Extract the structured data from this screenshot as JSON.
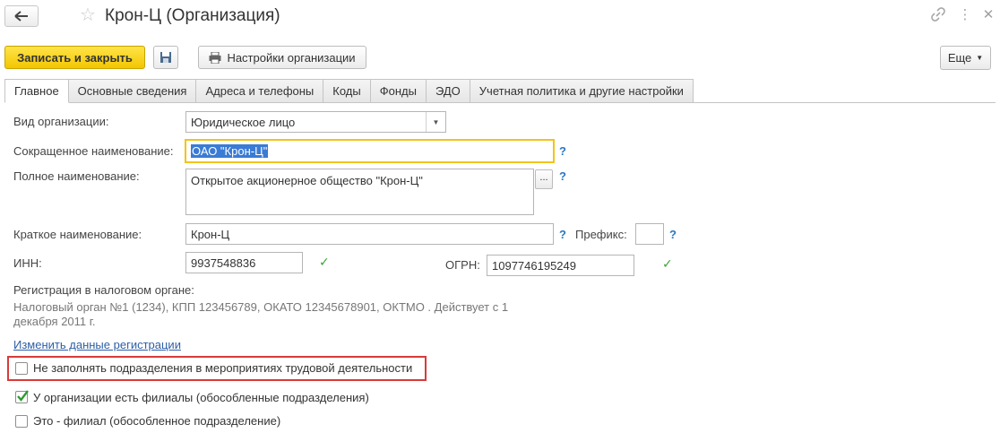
{
  "window": {
    "title": "Крон-Ц (Организация)"
  },
  "toolbar": {
    "save_close_label": "Записать и закрыть",
    "settings_label": "Настройки организации",
    "more_label": "Еще"
  },
  "tabs": [
    {
      "label": "Главное"
    },
    {
      "label": "Основные сведения"
    },
    {
      "label": "Адреса и телефоны"
    },
    {
      "label": "Коды"
    },
    {
      "label": "Фонды"
    },
    {
      "label": "ЭДО"
    },
    {
      "label": "Учетная политика и другие настройки"
    }
  ],
  "form": {
    "org_type_label": "Вид организации:",
    "org_type_value": "Юридическое лицо",
    "short_name_label": "Сокращенное наименование:",
    "short_name_value": "ОАО \"Крон-Ц\"",
    "full_name_label": "Полное наименование:",
    "full_name_value": "Открытое акционерное общество \"Крон-Ц\"",
    "brief_name_label": "Краткое наименование:",
    "brief_name_value": "Крон-Ц",
    "prefix_label": "Префикс:",
    "prefix_value": "",
    "inn_label": "ИНН:",
    "inn_value": "9937548836",
    "ogrn_label": "ОГРН:",
    "ogrn_value": "1097746195249",
    "help_mark": "?",
    "ellipsis": "...",
    "tax_reg_label": "Регистрация в налоговом органе:",
    "tax_reg_line1": "Налоговый орган №1 (1234), КПП 123456789, ОКАТО 12345678901, ОКТМО . Действует с 1",
    "tax_reg_line2": "декабря 2011 г.",
    "change_reg_link": "Изменить данные регистрации"
  },
  "checkboxes": [
    {
      "label": "Не заполнять подразделения в мероприятиях трудовой деятельности",
      "checked": false
    },
    {
      "label": "У организации есть филиалы (обособленные подразделения)",
      "checked": true
    },
    {
      "label": "Это - филиал (обособленное подразделение)",
      "checked": false
    }
  ],
  "colors": {
    "primary_button": "#f3c600",
    "focus_border": "#f3c319",
    "highlight_border": "#d83a3a",
    "link": "#2d5fa7",
    "help": "#2b77c0",
    "valid_check": "#3aa53a"
  },
  "icons": {
    "back": "arrow-left-icon",
    "favorite": "star-icon",
    "link": "link-icon",
    "menu": "more-vertical-icon",
    "close": "close-icon",
    "save": "floppy-disk-icon",
    "print": "printer-icon",
    "dropdown": "chevron-down-icon",
    "valid": "checkmark-icon"
  }
}
